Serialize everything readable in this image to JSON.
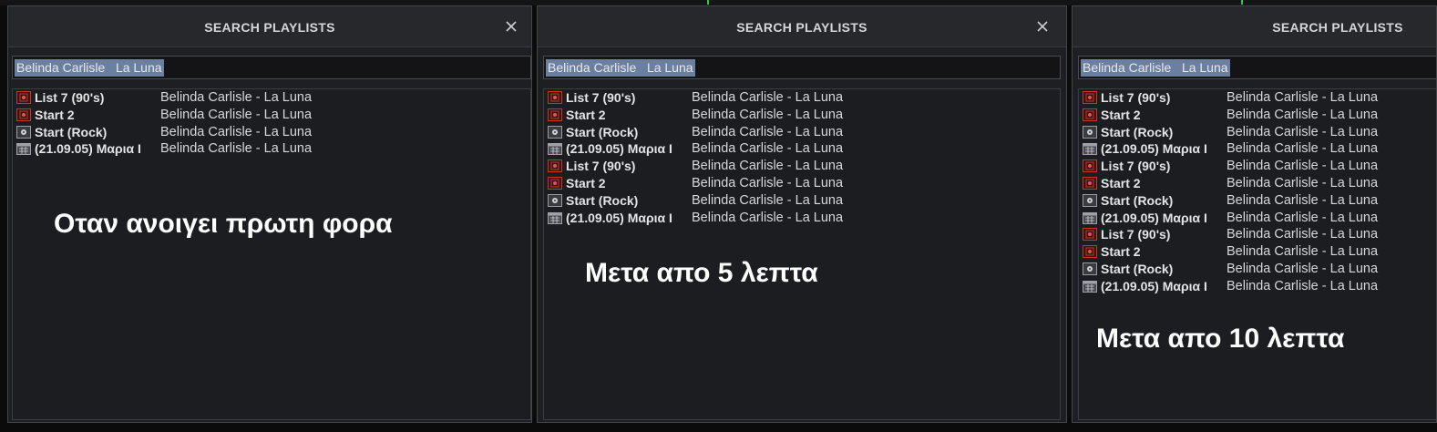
{
  "colors": {
    "background": "#0b0b0c",
    "panel": "#1e1f23",
    "header": "#27282c",
    "selection": "#6b7f9e",
    "caption": "#ffffff",
    "playlist_icon_red": "#c0392b",
    "playlist_icon_gray": "#8a8b90"
  },
  "panels": [
    {
      "title": "SEARCH PLAYLISTS",
      "search_value": "Belinda Carlisle   La Luna",
      "caption": "Οταν ανοιγει πρωτη φορα",
      "results": [
        {
          "name": "List 7 (90's)",
          "match": "Belinda Carlisle - La Luna",
          "icon": "red-playlist-icon"
        },
        {
          "name": "Start 2",
          "match": "Belinda Carlisle - La Luna",
          "icon": "red-playlist-icon"
        },
        {
          "name": "Start (Rock)",
          "match": "Belinda Carlisle - La Luna",
          "icon": "gray-playlist-icon"
        },
        {
          "name": "(21.09.05) Μαρια Ι",
          "match": "Belinda Carlisle - La Luna",
          "icon": "calendar-playlist-icon"
        }
      ]
    },
    {
      "title": "SEARCH PLAYLISTS",
      "search_value": "Belinda Carlisle   La Luna",
      "caption": "Μετα απο 5 λεπτα",
      "results": [
        {
          "name": "List 7 (90's)",
          "match": "Belinda Carlisle - La Luna",
          "icon": "red-playlist-icon"
        },
        {
          "name": "Start 2",
          "match": "Belinda Carlisle - La Luna",
          "icon": "red-playlist-icon"
        },
        {
          "name": "Start (Rock)",
          "match": "Belinda Carlisle - La Luna",
          "icon": "gray-playlist-icon"
        },
        {
          "name": "(21.09.05) Μαρια Ι",
          "match": "Belinda Carlisle - La Luna",
          "icon": "calendar-playlist-icon"
        },
        {
          "name": "List 7 (90's)",
          "match": "Belinda Carlisle - La Luna",
          "icon": "red-playlist-icon"
        },
        {
          "name": "Start 2",
          "match": "Belinda Carlisle - La Luna",
          "icon": "red-playlist-icon"
        },
        {
          "name": "Start (Rock)",
          "match": "Belinda Carlisle - La Luna",
          "icon": "gray-playlist-icon"
        },
        {
          "name": "(21.09.05) Μαρια Ι",
          "match": "Belinda Carlisle - La Luna",
          "icon": "calendar-playlist-icon"
        }
      ]
    },
    {
      "title": "SEARCH PLAYLISTS",
      "search_value": "Belinda Carlisle   La Luna",
      "caption": "Μετα απο 10 λεπτα",
      "results": [
        {
          "name": "List 7 (90's)",
          "match": "Belinda Carlisle - La Luna",
          "icon": "red-playlist-icon"
        },
        {
          "name": "Start 2",
          "match": "Belinda Carlisle - La Luna",
          "icon": "red-playlist-icon"
        },
        {
          "name": "Start (Rock)",
          "match": "Belinda Carlisle - La Luna",
          "icon": "gray-playlist-icon"
        },
        {
          "name": "(21.09.05) Μαρια Ι",
          "match": "Belinda Carlisle - La Luna",
          "icon": "calendar-playlist-icon"
        },
        {
          "name": "List 7 (90's)",
          "match": "Belinda Carlisle - La Luna",
          "icon": "red-playlist-icon"
        },
        {
          "name": "Start 2",
          "match": "Belinda Carlisle - La Luna",
          "icon": "red-playlist-icon"
        },
        {
          "name": "Start (Rock)",
          "match": "Belinda Carlisle - La Luna",
          "icon": "gray-playlist-icon"
        },
        {
          "name": "(21.09.05) Μαρια Ι",
          "match": "Belinda Carlisle - La Luna",
          "icon": "calendar-playlist-icon"
        },
        {
          "name": "List 7 (90's)",
          "match": "Belinda Carlisle - La Luna",
          "icon": "red-playlist-icon"
        },
        {
          "name": "Start 2",
          "match": "Belinda Carlisle - La Luna",
          "icon": "red-playlist-icon"
        },
        {
          "name": "Start (Rock)",
          "match": "Belinda Carlisle - La Luna",
          "icon": "gray-playlist-icon"
        },
        {
          "name": "(21.09.05) Μαρια Ι",
          "match": "Belinda Carlisle - La Luna",
          "icon": "calendar-playlist-icon"
        }
      ]
    }
  ]
}
